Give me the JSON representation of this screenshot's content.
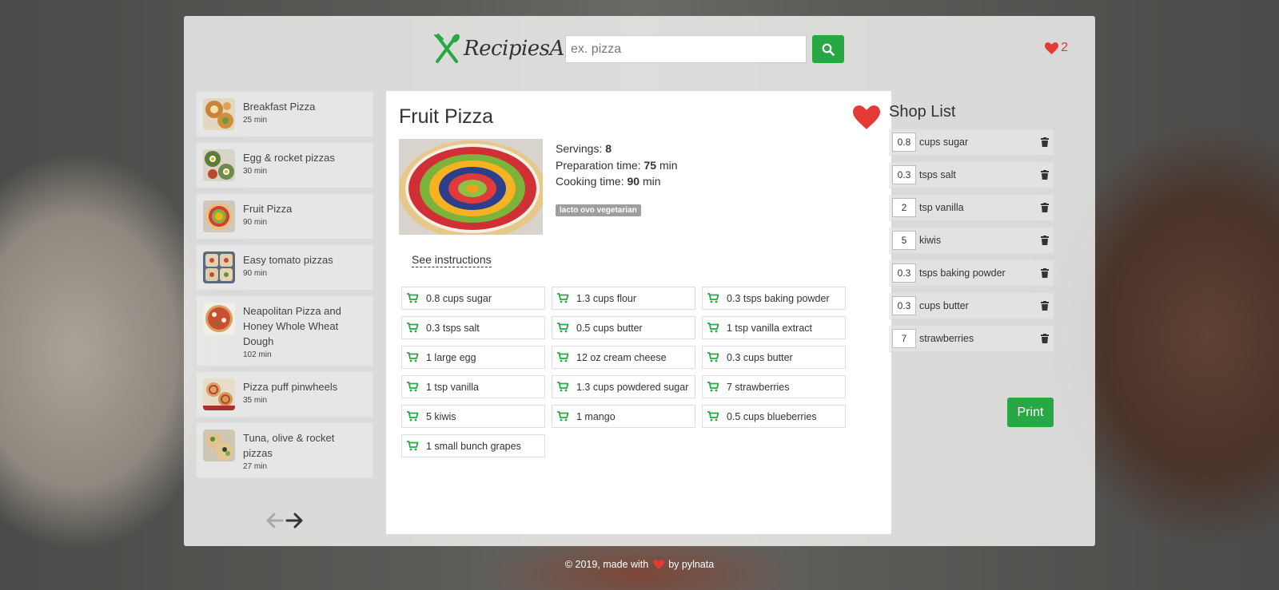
{
  "header": {
    "logo_text": "RecipiesApp",
    "search_placeholder": "ex. pizza",
    "likes_count": "2"
  },
  "results": [
    {
      "title": "Breakfast Pizza",
      "time": "25 min",
      "thumb_color": "#c9843a"
    },
    {
      "title": "Egg & rocket pizzas",
      "time": "30 min",
      "thumb_color": "#6e8b4c"
    },
    {
      "title": "Fruit Pizza",
      "time": "90 min",
      "thumb_color": "#d86a4b"
    },
    {
      "title": "Easy tomato pizzas",
      "time": "90 min",
      "thumb_color": "#b7b0a0"
    },
    {
      "title": "Neapolitan Pizza and Honey Whole Wheat Dough",
      "time": "102 min",
      "thumb_color": "#c94e32"
    },
    {
      "title": "Pizza puff pinwheels",
      "time": "35 min",
      "thumb_color": "#c98b55"
    },
    {
      "title": "Tuna, olive & rocket pizzas",
      "time": "27 min",
      "thumb_color": "#a7a07c"
    }
  ],
  "recipe": {
    "title": "Fruit Pizza",
    "servings_label": "Servings:",
    "servings": "8",
    "prep_label": "Preparation time:",
    "prep_time": "75",
    "cook_label": "Cooking time:",
    "cook_time": "90",
    "unit": "min",
    "badge": "lacto ovo vegetarian",
    "instructions_link": "See instructions",
    "ingredients": [
      "0.8 cups sugar",
      "1.3 cups flour",
      "0.3 tsps baking powder",
      "0.3 tsps salt",
      "0.5 cups butter",
      "1 tsp vanilla extract",
      "1 large egg",
      "12 oz cream cheese",
      "0.3 cups butter",
      "1 tsp vanilla",
      "1.3 cups powdered sugar",
      "7 strawberries",
      "5 kiwis",
      "1 mango",
      "0.5 cups blueberries",
      "1 small bunch grapes"
    ]
  },
  "shop": {
    "title": "Shop List",
    "items": [
      {
        "qty": "0.8",
        "name": "cups sugar"
      },
      {
        "qty": "0.3",
        "name": "tsps salt"
      },
      {
        "qty": "2",
        "name": "tsp vanilla"
      },
      {
        "qty": "5",
        "name": "kiwis"
      },
      {
        "qty": "0.3",
        "name": "tsps baking powder"
      },
      {
        "qty": "0.3",
        "name": "cups butter"
      },
      {
        "qty": "7",
        "name": "strawberries"
      }
    ],
    "print_label": "Print"
  },
  "footer": {
    "prefix": "© 2019, made with",
    "suffix": "by pylnata"
  },
  "colors": {
    "accent": "#28a745",
    "heart": "#e53935"
  }
}
